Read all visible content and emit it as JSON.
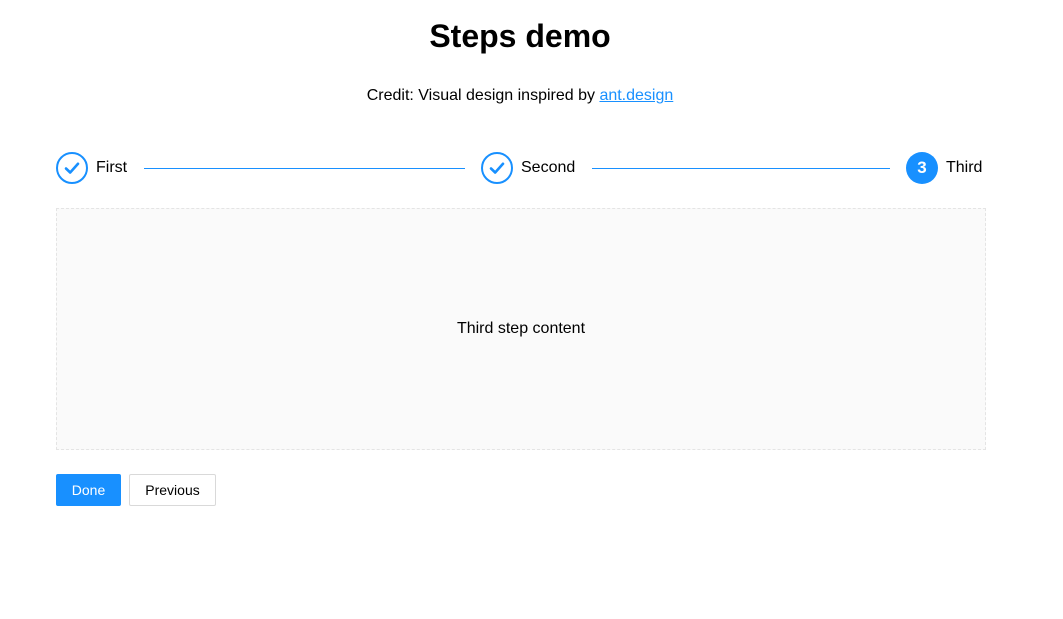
{
  "header": {
    "title": "Steps demo",
    "credit_prefix": "Credit: Visual design inspired by ",
    "credit_link": "ant.design"
  },
  "steps": [
    {
      "label": "First",
      "status": "finished",
      "icon": "check-icon"
    },
    {
      "label": "Second",
      "status": "finished",
      "icon": "check-icon"
    },
    {
      "label": "Third",
      "status": "current",
      "number": "3"
    }
  ],
  "content": {
    "text": "Third step content"
  },
  "buttons": {
    "done": "Done",
    "previous": "Previous"
  },
  "colors": {
    "accent": "#1890ff",
    "content_bg": "#fafafa",
    "content_border": "#e4e4e4"
  }
}
